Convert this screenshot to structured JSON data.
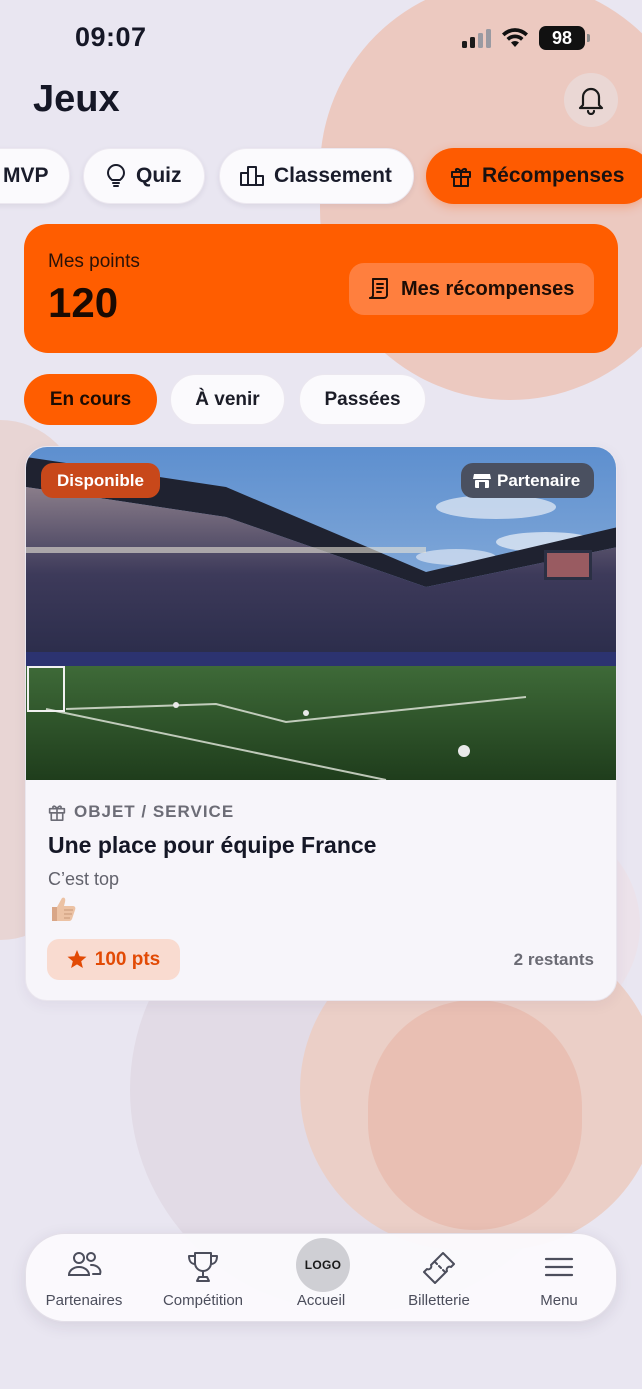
{
  "status_bar": {
    "time": "09:07",
    "battery": "98"
  },
  "header": {
    "title": "Jeux"
  },
  "tabs": [
    {
      "label": "MVP"
    },
    {
      "label": "Quiz",
      "icon": "lightbulb-icon"
    },
    {
      "label": "Classement",
      "icon": "leaderboard-icon"
    },
    {
      "label": "Récompenses",
      "icon": "gift-icon",
      "active": true
    }
  ],
  "points_card": {
    "label": "Mes points",
    "value": "120",
    "button_label": "Mes récompenses"
  },
  "filters": [
    {
      "label": "En cours",
      "active": true
    },
    {
      "label": "À venir"
    },
    {
      "label": "Passées"
    }
  ],
  "reward": {
    "status_badge": "Disponible",
    "partner_badge": "Partenaire",
    "category": "OBJET / SERVICE",
    "title": "Une place pour équipe France",
    "description": "C’est top",
    "emoji": "thumbs-up",
    "points": "100 pts",
    "remaining": "2 restants"
  },
  "bottom_nav": {
    "items": [
      {
        "label": "Partenaires",
        "icon": "people-icon"
      },
      {
        "label": "Compétition",
        "icon": "trophy-icon"
      },
      {
        "label": "Accueil",
        "logo_text": "LOGO"
      },
      {
        "label": "Billetterie",
        "icon": "ticket-icon"
      },
      {
        "label": "Menu",
        "icon": "hamburger-icon"
      }
    ]
  },
  "colors": {
    "accent": "#ff5d00",
    "text": "#151726"
  }
}
